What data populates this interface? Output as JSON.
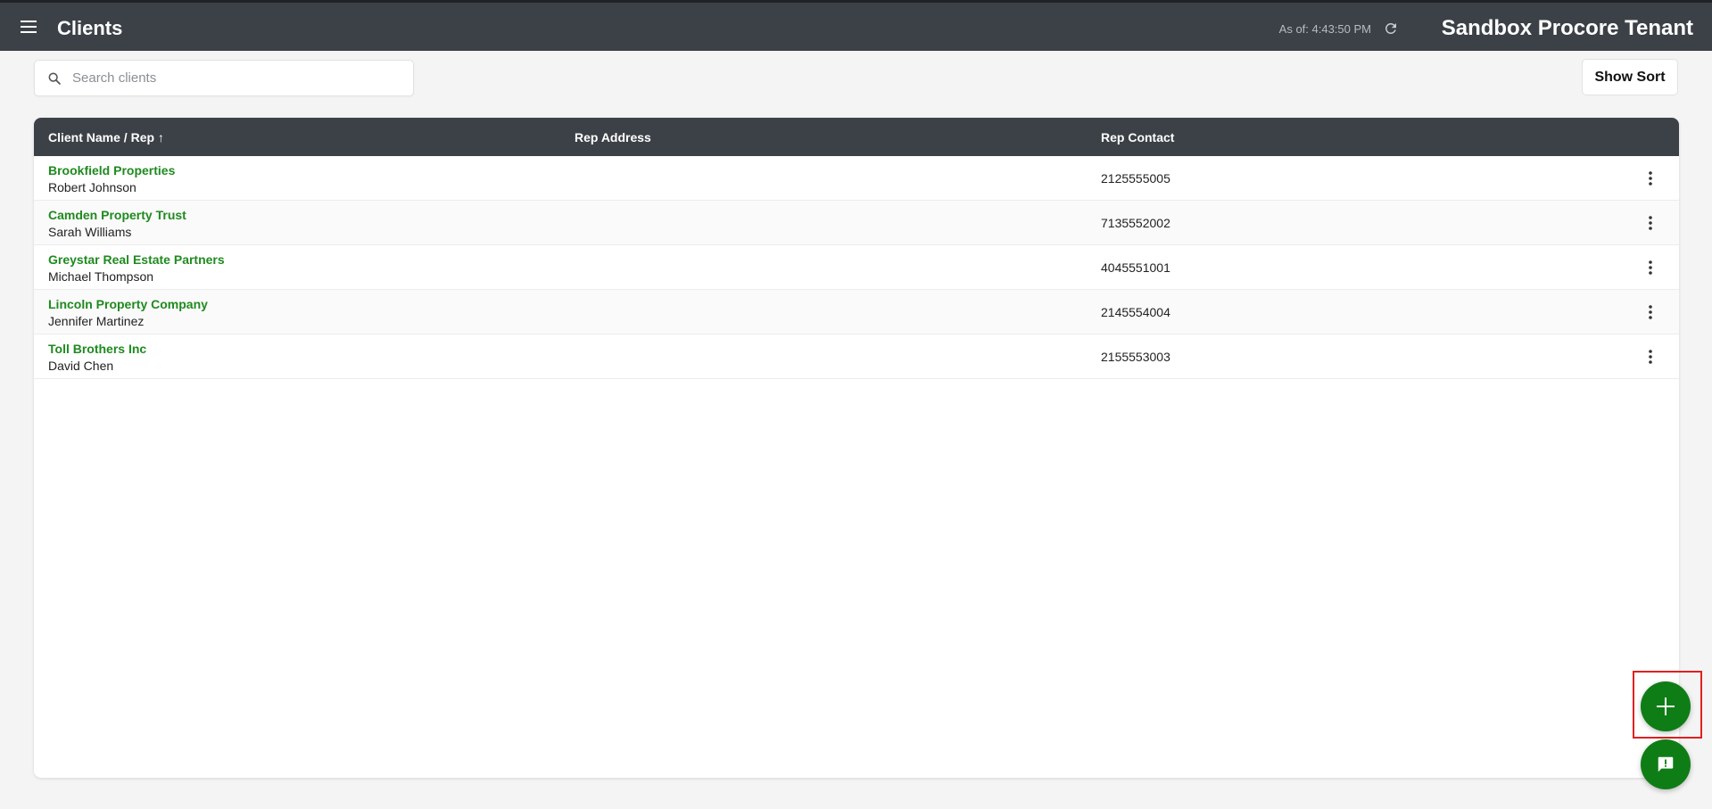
{
  "header": {
    "title": "Clients",
    "as_of": "As of: 4:43:50 PM",
    "tenant": "Sandbox Procore Tenant"
  },
  "toolbar": {
    "search_placeholder": "Search clients",
    "search_value": "",
    "show_sort_label": "Show Sort"
  },
  "table": {
    "columns": [
      "Client Name / Rep ↑",
      "Rep Address",
      "Rep Contact"
    ],
    "rows": [
      {
        "client": "Brookfield Properties",
        "rep": "Robert Johnson",
        "address": "",
        "contact": "2125555005"
      },
      {
        "client": "Camden Property Trust",
        "rep": "Sarah Williams",
        "address": "",
        "contact": "7135552002"
      },
      {
        "client": "Greystar Real Estate Partners",
        "rep": "Michael Thompson",
        "address": "",
        "contact": "4045551001"
      },
      {
        "client": "Lincoln Property Company",
        "rep": "Jennifer Martinez",
        "address": "",
        "contact": "2145554004"
      },
      {
        "client": "Toll Brothers Inc",
        "rep": "David Chen",
        "address": "",
        "contact": "2155553003"
      }
    ]
  },
  "icons": {
    "menu": "hamburger-menu-icon",
    "refresh": "refresh-icon",
    "search": "search-icon",
    "row_actions": "more-vertical-icon",
    "add": "plus-icon",
    "feedback": "feedback-icon"
  },
  "colors": {
    "header_bg": "#3c4147",
    "link_green": "#1f8a1f",
    "fab_green": "#0f7d16",
    "highlight_red": "#e02020"
  }
}
